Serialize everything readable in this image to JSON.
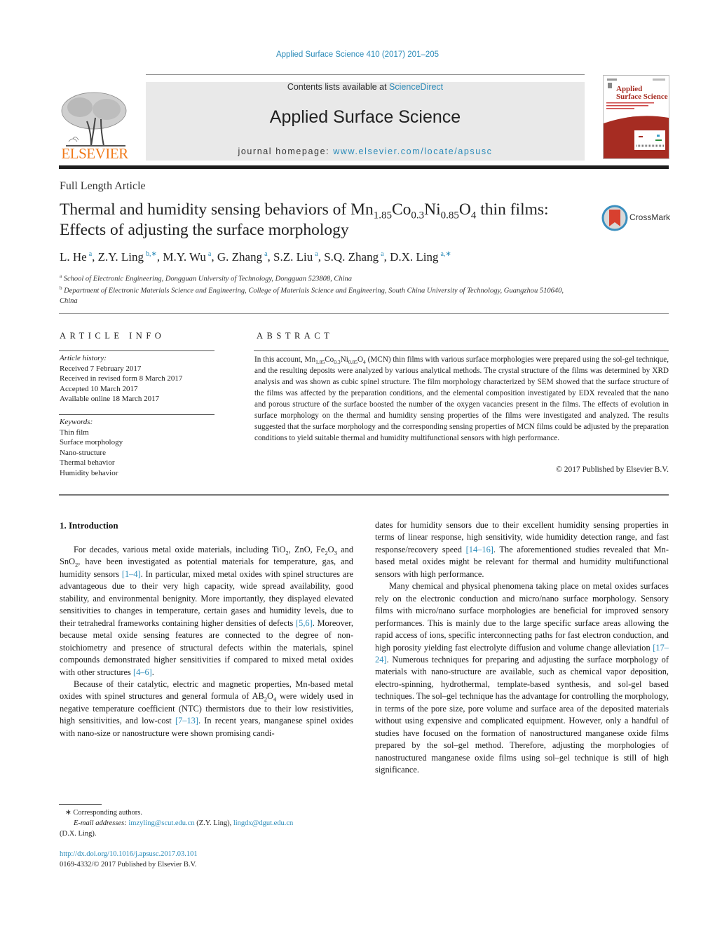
{
  "header": {
    "running_head": "Applied Surface Science 410 (2017) 201–205",
    "contents_prefix": "Contents lists available at ",
    "contents_link": "ScienceDirect",
    "journal_name": "Applied Surface Science",
    "homepage_prefix": "journal homepage: ",
    "homepage_link": "www.elsevier.com/locate/apsusc",
    "publisher_logo_text": "ELSEVIER",
    "cover_title_line1": "Applied",
    "cover_title_line2": "Surface Science",
    "colors": {
      "link": "#2a8ab8",
      "elsevier_orange": "#f07a1a",
      "cover_red": "#a62c22",
      "masthead_bg": "#e9e9e9"
    }
  },
  "article": {
    "type": "Full Length Article",
    "title_part1": "Thermal and humidity sensing behaviors of Mn",
    "title_sub1": "1.85",
    "title_part2": "Co",
    "title_sub2": "0.3",
    "title_part3": "Ni",
    "title_sub3": "0.85",
    "title_part4": "O",
    "title_sub4": "4",
    "title_part5": " thin films: Effects of adjusting the surface morphology",
    "crossmark_label": "CrossMark",
    "authors": [
      {
        "name": "L. He",
        "sup": "a"
      },
      {
        "name": "Z.Y. Ling",
        "sup": "b,∗"
      },
      {
        "name": "M.Y. Wu",
        "sup": "a"
      },
      {
        "name": "G. Zhang",
        "sup": "a"
      },
      {
        "name": "S.Z. Liu",
        "sup": "a"
      },
      {
        "name": "S.Q. Zhang",
        "sup": "a"
      },
      {
        "name": "D.X. Ling",
        "sup": "a,∗"
      }
    ],
    "affiliations": [
      {
        "mark": "a",
        "text": "School of Electronic Engineering, Dongguan University of Technology, Dongguan 523808, China"
      },
      {
        "mark": "b",
        "text": "Department of Electronic Materials Science and Engineering, College of Materials Science and Engineering, South China University of Technology, Guangzhou 510640, China"
      }
    ]
  },
  "article_info": {
    "heading": "ARTICLE INFO",
    "history_label": "Article history:",
    "history": [
      "Received 7 February 2017",
      "Received in revised form 8 March 2017",
      "Accepted 10 March 2017",
      "Available online 18 March 2017"
    ],
    "keywords_label": "Keywords:",
    "keywords": [
      "Thin film",
      "Surface morphology",
      "Nano-structure",
      "Thermal behavior",
      "Humidity behavior"
    ]
  },
  "abstract": {
    "heading": "ABSTRACT",
    "lead": "In this account, Mn",
    "s1": "1.85",
    "co": "Co",
    "s2": "0.3",
    "ni": "Ni",
    "s3": "0.85",
    "o": "O",
    "s4": "4",
    "body": " (MCN) thin films with various surface morphologies were prepared using the sol-gel technique, and the resulting deposits were analyzed by various analytical methods. The crystal structure of the films was determined by XRD analysis and was shown as cubic spinel structure. The film morphology characterized by SEM showed that the surface structure of the films was affected by the preparation conditions, and the elemental composition investigated by EDX revealed that the nano and porous structure of the surface boosted the number of the oxygen vacancies present in the films. The effects of evolution in surface morphology on the thermal and humidity sensing properties of the films were investigated and analyzed. The results suggested that the surface morphology and the corresponding sensing properties of MCN films could be adjusted by the preparation conditions to yield suitable thermal and humidity multifunctional sensors with high performance.",
    "copyright": "© 2017 Published by Elsevier B.V."
  },
  "introduction": {
    "heading": "1.  Introduction",
    "p1": {
      "a": "For decades, various metal oxide materials, including TiO",
      "a_sub": "2",
      "b": ", ZnO, Fe",
      "b_sub": "2",
      "c": "O",
      "c_sub": "3",
      "d": " and SnO",
      "d_sub": "2",
      "e": ", have been investigated as potential materials for temperature, gas, and humidity sensors ",
      "ref1": "[1–4]",
      "f": ". In particular, mixed metal oxides with spinel structures are advantageous due to their very high capacity, wide spread availability, good stability, and environmental benignity. More importantly, they displayed elevated sensitivities to changes in temperature, certain gases and humidity levels, due to their tetrahedral frameworks containing higher densities of defects ",
      "ref2": "[5,6]",
      "g": ". Moreover, because metal oxide sensing features are connected to the degree of non-stoichiometry and presence of structural defects within the materials, spinel compounds demonstrated higher sensitivities if compared to mixed metal oxides with other structures ",
      "ref3": "[4–6]",
      "h": "."
    },
    "p2": {
      "a": "Because of their catalytic, electric and magnetic properties, Mn-based metal oxides with spinel structures and general formula of AB",
      "a_sub": "2",
      "b": "O",
      "b_sub": "4",
      "c": " were widely used in negative temperature coefficient (NTC) thermistors due to their low resistivities, high sensitivities, and low-cost ",
      "ref1": "[7–13]",
      "d": ". In recent years, manganese spinel oxides with nano-size or nanostructure were shown promising candidates for humidity sensors due to their excellent humidity sensing properties in terms of linear response, high sensitivity, wide humidity detection range, and fast response/recovery speed ",
      "ref2": "[14–16]",
      "e": ". The aforementioned studies revealed that Mn-based metal oxides might be relevant for thermal and humidity multifunctional sensors with high performance."
    },
    "p2_left": "Because of their catalytic, electric and magnetic properties, Mn-based metal oxides with spinel structures and general formula of AB",
    "p2_left_rest": " were widely used in negative temperature coefficient (NTC) thermistors due to their low resistivities, high sensitivities, and low-cost ",
    "p2_left_ref": "[7–13]",
    "p2_left_tail": ". In recent years, manganese spinel oxides with nano-size or nanostructure were shown promising candi-",
    "p2_right_head": "dates for humidity sensors due to their excellent humidity sensing properties in terms of linear response, high sensitivity, wide humidity detection range, and fast response/recovery speed ",
    "p2_right_ref": "[14–16]",
    "p2_right_tail": ". The aforementioned studies revealed that Mn-based metal oxides might be relevant for thermal and humidity multifunctional sensors with high performance.",
    "p3": {
      "a": "Many chemical and physical phenomena taking place on metal oxides surfaces rely on the electronic conduction and micro/nano surface morphology. Sensory films with micro/nano surface morphologies are beneficial for improved sensory performances. This is mainly due to the large specific surface areas allowing the rapid access of ions, specific interconnecting paths for fast electron conduction, and high porosity yielding fast electrolyte diffusion and volume change alleviation ",
      "ref1": "[17–24]",
      "b": ". Numerous techniques for preparing and adjusting the surface morphology of materials with nano-structure are available, such as chemical vapor deposition, electro-spinning, hydrothermal, template-based synthesis, and sol-gel based techniques. The sol–gel technique has the advantage for controlling the morphology, in terms of the pore size, pore volume and surface area of the deposited materials without using expensive and complicated equipment. However, only a handful of studies have focused on the formation of nanostructured manganese oxide films prepared by the sol–gel method. Therefore, adjusting the morphologies of nanostructured manganese oxide films using sol–gel technique is still of high significance."
    }
  },
  "footnotes": {
    "corresponding": "∗  Corresponding authors.",
    "email_label": "E-mail addresses: ",
    "email1": "imzyling@scut.edu.cn",
    "email1_owner": " (Z.Y. Ling), ",
    "email2": "lingdx@dgut.edu.cn",
    "email2_owner": "(D.X. Ling).",
    "doi": "http://dx.doi.org/10.1016/j.apsusc.2017.03.101",
    "issn_line": "0169-4332/© 2017 Published by Elsevier B.V."
  }
}
